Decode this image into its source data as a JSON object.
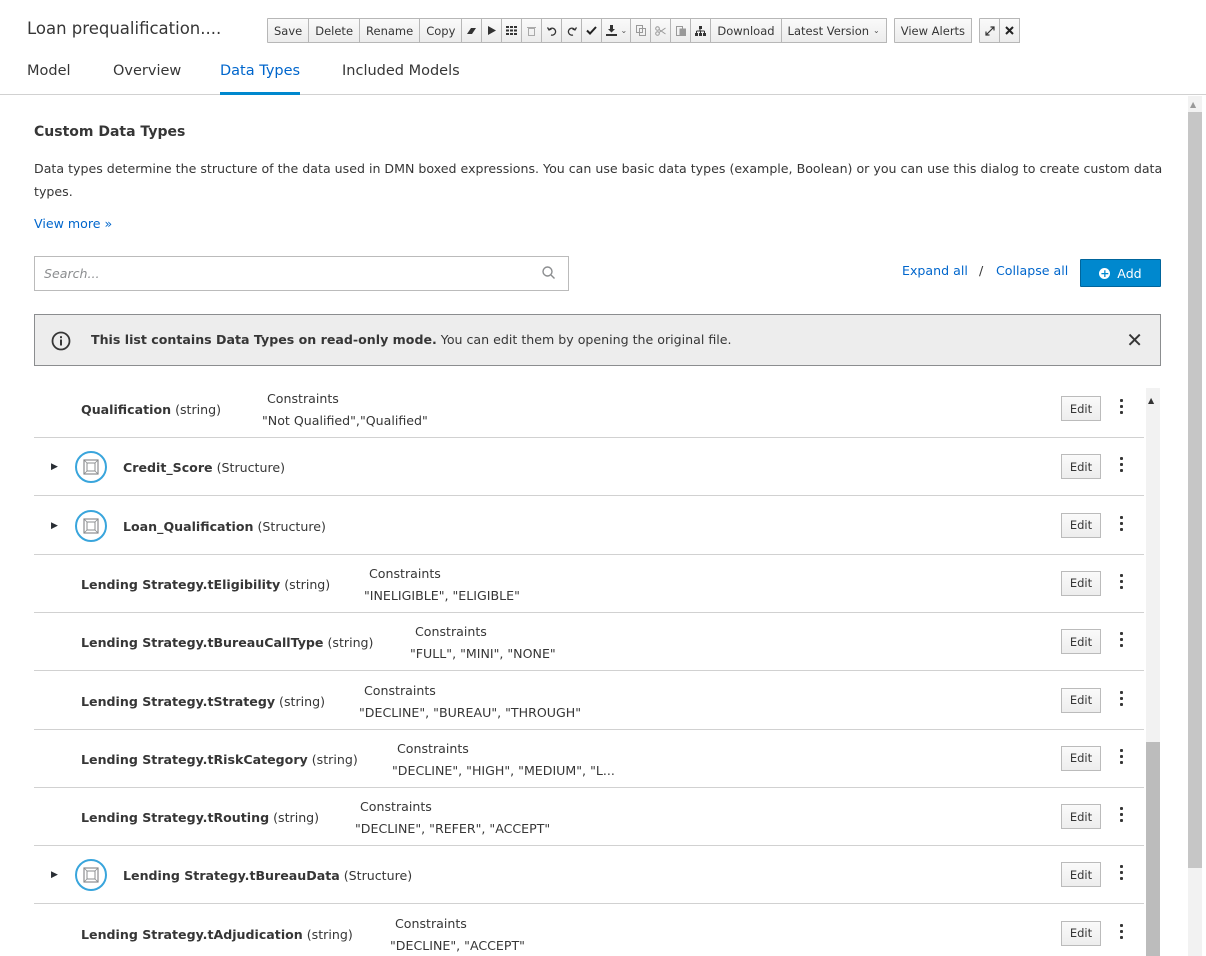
{
  "title": "Loan prequalification....",
  "toolbar": {
    "save": "Save",
    "delete": "Delete",
    "rename": "Rename",
    "copy": "Copy",
    "download": "Download",
    "latest_version": "Latest Version",
    "view_alerts": "View Alerts",
    "icons": [
      "eraser-icon",
      "play-icon",
      "grid-icon",
      "trash-icon",
      "undo-icon",
      "redo-icon",
      "check-icon",
      "import-icon",
      "copy-icon",
      "cut-icon",
      "paste-icon",
      "hierarchy-icon",
      "expand-icon",
      "close-icon"
    ]
  },
  "tabs": [
    {
      "label": "Model"
    },
    {
      "label": "Overview"
    },
    {
      "label": "Data Types"
    },
    {
      "label": "Included Models"
    }
  ],
  "active_tab": "Data Types",
  "section": {
    "heading": "Custom Data Types",
    "description": "Data types determine the structure of the data used in DMN boxed expressions. You can use basic data types (example, Boolean) or you can use this dialog to create custom data types.",
    "view_more": "View more »"
  },
  "search": {
    "placeholder": "Search...",
    "value": ""
  },
  "actions": {
    "expand_all": "Expand all",
    "separator": "/",
    "collapse_all": "Collapse all",
    "add": "Add"
  },
  "alert": {
    "bold": "This list contains Data Types on read-only mode.",
    "text": " You can edit them by opening the original file.",
    "close": "✕"
  },
  "colors": {
    "accent": "#0088ce",
    "link": "#0066cc",
    "alert_bg": "#ededed"
  },
  "rows": [
    {
      "name": "Qualification",
      "type": "(string)",
      "structure": false,
      "constraints_label": "Constraints",
      "constraints": "\"Not Qualified\",\"Qualified\"",
      "edit": "Edit"
    },
    {
      "name": "Credit_Score",
      "type": "(Structure)",
      "structure": true,
      "constraints_label": "",
      "constraints": "",
      "edit": "Edit"
    },
    {
      "name": "Loan_Qualification",
      "type": "(Structure)",
      "structure": true,
      "constraints_label": "",
      "constraints": "",
      "edit": "Edit"
    },
    {
      "name": "Lending Strategy.tEligibility",
      "type": "(string)",
      "structure": false,
      "constraints_label": "Constraints",
      "constraints": "\"INELIGIBLE\", \"ELIGIBLE\"",
      "edit": "Edit"
    },
    {
      "name": "Lending Strategy.tBureauCallType",
      "type": "(string)",
      "structure": false,
      "constraints_label": "Constraints",
      "constraints": "\"FULL\", \"MINI\", \"NONE\"",
      "edit": "Edit"
    },
    {
      "name": "Lending Strategy.tStrategy",
      "type": "(string)",
      "structure": false,
      "constraints_label": "Constraints",
      "constraints": "\"DECLINE\", \"BUREAU\", \"THROUGH\"",
      "edit": "Edit"
    },
    {
      "name": "Lending Strategy.tRiskCategory",
      "type": "(string)",
      "structure": false,
      "constraints_label": "Constraints",
      "constraints": "\"DECLINE\", \"HIGH\", \"MEDIUM\", \"L...",
      "edit": "Edit"
    },
    {
      "name": "Lending Strategy.tRouting",
      "type": "(string)",
      "structure": false,
      "constraints_label": "Constraints",
      "constraints": "\"DECLINE\", \"REFER\", \"ACCEPT\"",
      "edit": "Edit"
    },
    {
      "name": "Lending Strategy.tBureauData",
      "type": "(Structure)",
      "structure": true,
      "constraints_label": "",
      "constraints": "",
      "edit": "Edit"
    },
    {
      "name": "Lending Strategy.tAdjudication",
      "type": "(string)",
      "structure": false,
      "constraints_label": "Constraints",
      "constraints": "\"DECLINE\", \"ACCEPT\"",
      "edit": "Edit"
    }
  ]
}
